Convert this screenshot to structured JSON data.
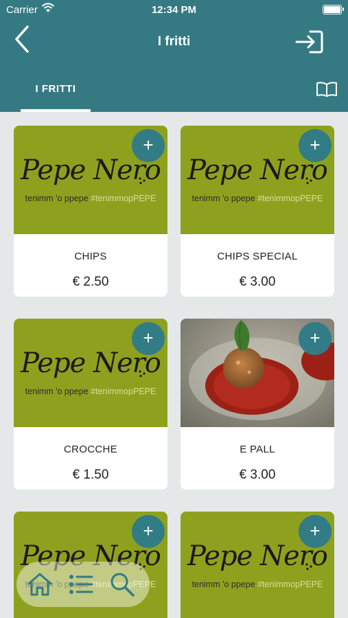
{
  "status_bar": {
    "carrier": "Carrier",
    "time": "12:34 PM"
  },
  "nav": {
    "title": "I fritti"
  },
  "tabs": [
    {
      "label": "I FRITTI"
    }
  ],
  "logo": {
    "script": "Pepe Nero",
    "tagline_plain": "tenimm 'o ppepe",
    "tagline_hash": "#tenimmopPEPE"
  },
  "products": [
    {
      "name": "CHIPS",
      "price": "€ 2.50",
      "add": "+"
    },
    {
      "name": "CHIPS SPECIAL",
      "price": "€ 3.00",
      "add": "+"
    },
    {
      "name": "CROCCHE",
      "price": "€ 1.50",
      "add": "+"
    },
    {
      "name": "E PALL",
      "price": "€ 3.00",
      "add": "+"
    },
    {
      "add": "+"
    },
    {
      "add": "+"
    }
  ],
  "colors": {
    "header": "#357a83",
    "accent": "#327c86",
    "placeholder": "#8ea11e",
    "background": "#e5e8e9"
  },
  "icons": [
    "back-chevron-icon",
    "login-icon",
    "book-icon",
    "home-icon",
    "list-icon",
    "search-icon",
    "plus-icon",
    "wifi-icon",
    "battery-icon"
  ]
}
